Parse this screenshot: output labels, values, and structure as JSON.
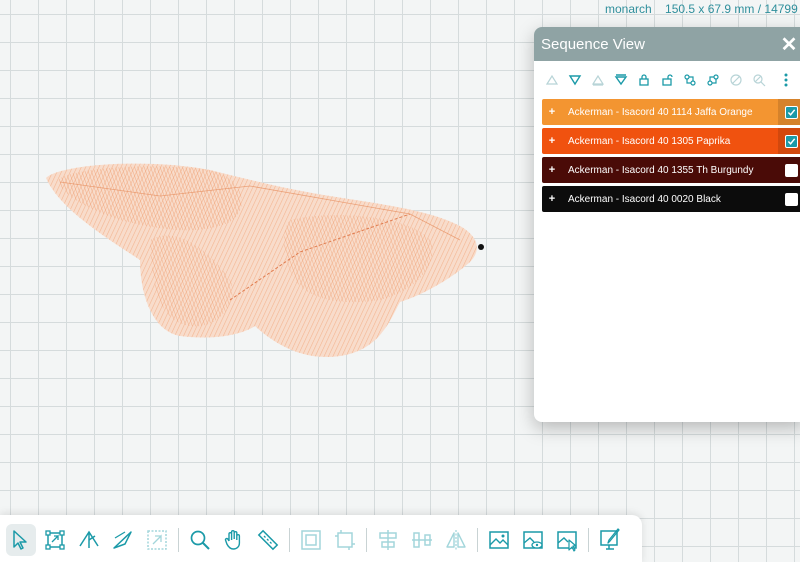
{
  "design": {
    "name": "monarch",
    "size": "150.5 x 67.9 mm / 14799 st"
  },
  "panel": {
    "title": "Sequence View",
    "close_glyph": "✕"
  },
  "toolbar_icons": [
    "move-first-icon",
    "move-up-icon",
    "move-down-icon",
    "move-last-icon",
    "lock-icon",
    "unlock-icon",
    "merge-icon",
    "split-icon",
    "hide-icon",
    "hide-all-icon",
    "more-options-icon"
  ],
  "colours": [
    {
      "expand": "+",
      "label": "Ackerman - Isacord 40 1114 Jaffa Orange",
      "color": "#f39531",
      "checked": true
    },
    {
      "expand": "+",
      "label": "Ackerman - Isacord 40 1305 Paprika",
      "color": "#f0520f",
      "checked": true
    },
    {
      "expand": "+",
      "label": "Ackerman - Isacord 40 1355 Th Burgundy",
      "color": "#4a0b07",
      "checked": false
    },
    {
      "expand": "+",
      "label": "Ackerman - Isacord 40 0020 Black",
      "color": "#0c0c0c",
      "checked": false
    }
  ],
  "bottom_tools": [
    "select-icon",
    "resize-icon",
    "node-edit-icon",
    "knife-icon",
    "wreath-icon",
    "zoom-icon",
    "pan-hand-icon",
    "ruler-icon",
    "group-icon",
    "ungroup-icon",
    "align-icon",
    "distribute-icon",
    "mirror-icon",
    "image-icon",
    "view-image-icon",
    "trace-image-icon",
    "digitize-icon"
  ],
  "accent": "#1b9aa8"
}
